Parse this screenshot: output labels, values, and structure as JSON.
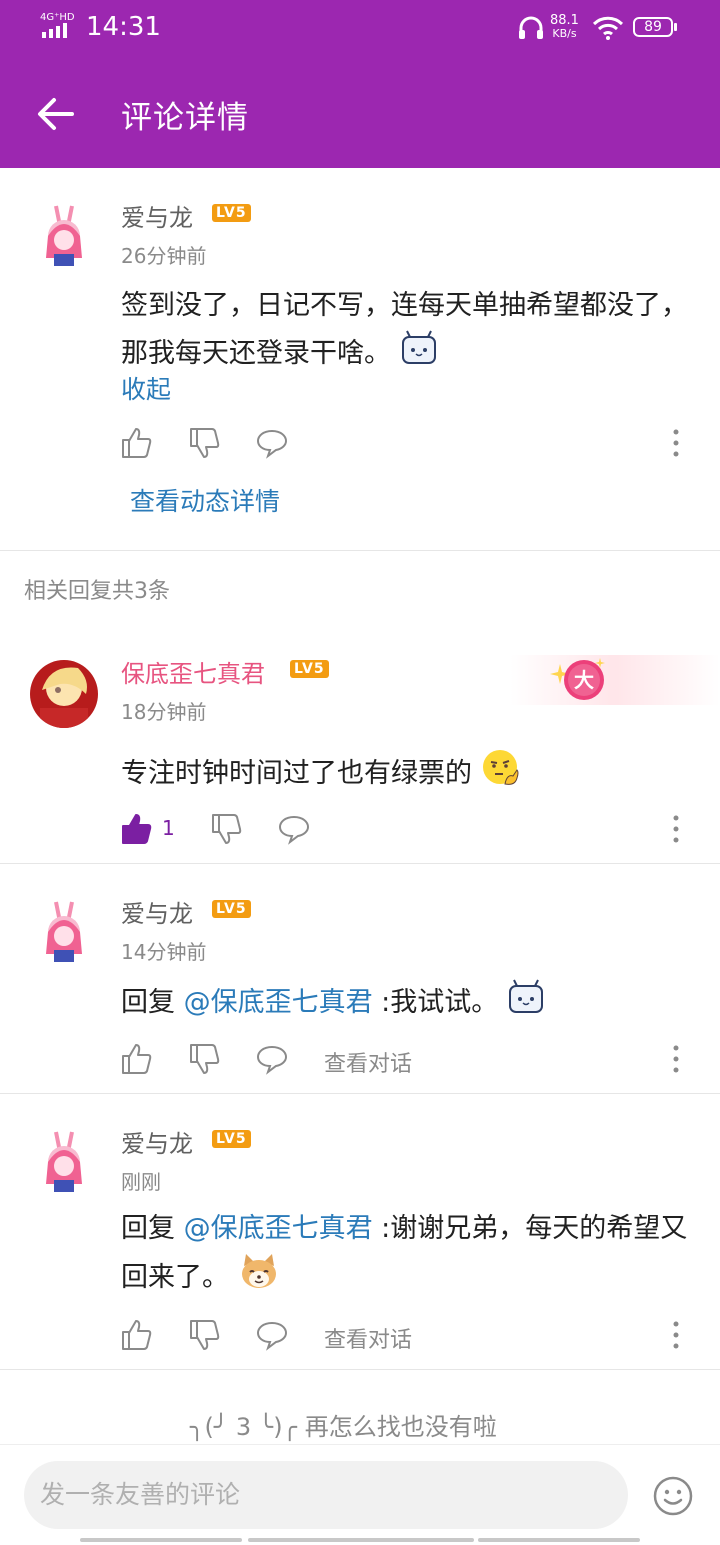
{
  "status_bar": {
    "network": "4G⁺HD",
    "time": "14:31",
    "speed_value": "88.1",
    "speed_unit": "KB/s",
    "battery": "89"
  },
  "app_bar": {
    "title": "评论详情"
  },
  "main_comment": {
    "username": "爱与龙",
    "level": "LV5",
    "time": "26分钟前",
    "body": "签到没了，日记不写，连每天单抽希望都没了，那我每天还登录干啥。",
    "collapse_label": "收起",
    "view_detail_label": "查看动态详情"
  },
  "replies_header": "相关回复共3条",
  "replies": [
    {
      "username": "保底歪七真君",
      "level": "LV5",
      "time": "18分钟前",
      "body": "专注时钟时间过了也有绿票的",
      "like_count": "1",
      "badge": "大"
    },
    {
      "username": "爱与龙",
      "level": "LV5",
      "time": "14分钟前",
      "reply_prefix": "回复 ",
      "mention": "@保底歪七真君",
      "body": " :我试试。",
      "view_dialog_label": "查看对话"
    },
    {
      "username": "爱与龙",
      "level": "LV5",
      "time": "刚刚",
      "reply_prefix": "回复 ",
      "mention": "@保底歪七真君",
      "body": " :谢谢兄弟，每天的希望又回来了。",
      "view_dialog_label": "查看对话"
    }
  ],
  "end_note": {
    "face": "╮(╯ 3 ╰)╭",
    "text": "再怎么找也没有啦"
  },
  "bottom_bar": {
    "input_placeholder": "发一条友善的评论"
  },
  "colors": {
    "primary": "#9c27b0",
    "link": "#2b7bb9",
    "level_badge": "#f39c12",
    "vip_name": "#e75480"
  },
  "icons": [
    "back-arrow-icon",
    "like-icon",
    "dislike-icon",
    "comment-icon",
    "more-icon",
    "emoji-icon"
  ]
}
